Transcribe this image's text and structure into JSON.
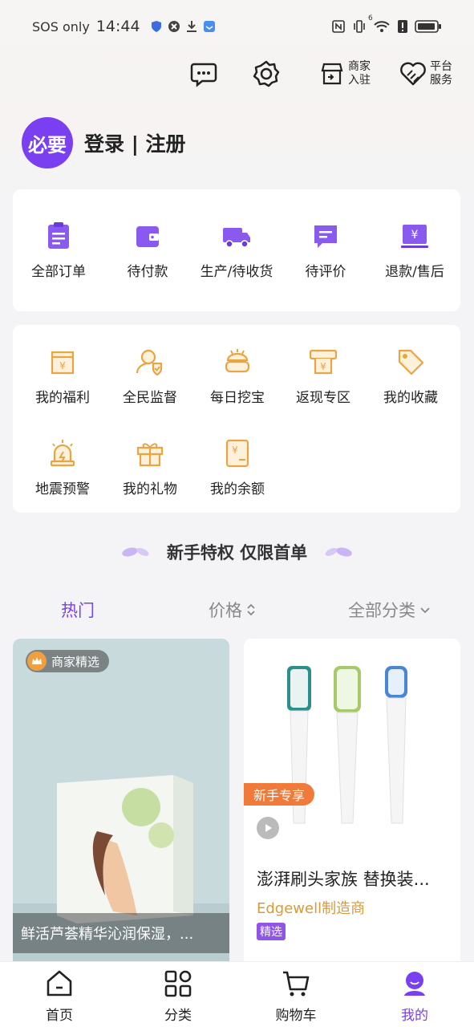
{
  "status_bar": {
    "sos": "SOS only",
    "time": "14:44",
    "network_label": "6"
  },
  "header": {
    "merchant_join_line1": "商家",
    "merchant_join_line2": "入驻",
    "platform_service_line1": "平台",
    "platform_service_line2": "服务"
  },
  "profile": {
    "avatar_text": "必要",
    "login_text": "登录 | 注册"
  },
  "orders": [
    {
      "label": "全部订单",
      "icon": "clipboard-icon"
    },
    {
      "label": "待付款",
      "icon": "wallet-icon"
    },
    {
      "label": "生产/待收货",
      "icon": "truck-icon"
    },
    {
      "label": "待评价",
      "icon": "comment-icon"
    },
    {
      "label": "退款/售后",
      "icon": "refund-icon"
    }
  ],
  "tools": [
    {
      "label": "我的福利",
      "icon": "welfare-icon"
    },
    {
      "label": "全民监督",
      "icon": "supervise-icon"
    },
    {
      "label": "每日挖宝",
      "icon": "treasure-icon"
    },
    {
      "label": "返现专区",
      "icon": "cashback-icon"
    },
    {
      "label": "我的收藏",
      "icon": "tag-icon"
    },
    {
      "label": "地震预警",
      "icon": "alarm-icon"
    },
    {
      "label": "我的礼物",
      "icon": "gift-icon"
    },
    {
      "label": "我的余额",
      "icon": "balance-icon"
    }
  ],
  "promo": {
    "title": "新手特权 仅限首单"
  },
  "filters": {
    "hot": "热门",
    "price": "价格",
    "category": "全部分类"
  },
  "products": [
    {
      "badge": "商家精选",
      "title": "鲜活芦荟精华沁润保湿，..."
    },
    {
      "tag": "新手专享",
      "title": "澎湃刷头家族  替换装...",
      "brand": "Edgewell制造商",
      "badge": "精选"
    }
  ],
  "tabbar": [
    {
      "label": "首页",
      "icon": "home-icon"
    },
    {
      "label": "分类",
      "icon": "category-icon"
    },
    {
      "label": "购物车",
      "icon": "cart-icon"
    },
    {
      "label": "我的",
      "icon": "profile-icon"
    }
  ],
  "colors": {
    "accent": "#7b3ff2",
    "order_icon": "#8a5af0",
    "tool_icon": "#e7a643",
    "brand_text": "#d69b3c",
    "new_tag": "#f07a3a"
  }
}
